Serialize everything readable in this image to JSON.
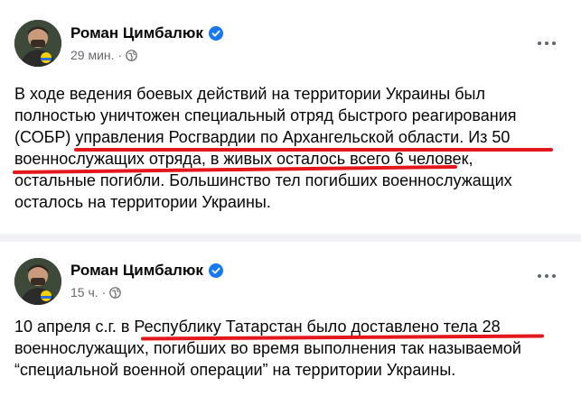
{
  "posts": [
    {
      "author": "Роман Цимбалюк",
      "time": "29 мин.",
      "separator": "·",
      "lines": [
        "В ходе ведения боевых действий на территории Украины был",
        "полностью уничтожен специальный отряд быстрого реагирования",
        "(СОБР) управления Росгвардии по Архангельской области.  Из 50",
        "военнослужащих отряда, в живых осталось всего 6 человек,",
        "остальные погибли. Большинство тел погибших военнослужащих",
        "осталось на территории Украины."
      ]
    },
    {
      "author": "Роман Цимбалюк",
      "time": "15 ч.",
      "separator": "·",
      "lines": [
        "10 апреля с.г. в Республику Татарстан было доставлено тела 28",
        "военнослужащих, погибших во время выполнения так называемой",
        "“специальной военной операции” на территории Украины."
      ]
    }
  ],
  "colors": {
    "verified_badge": "#1877f2",
    "annotation_underline": "#e4181c",
    "meta_text": "#65676b"
  },
  "icons": {
    "verified": "verified-badge-icon",
    "audience": "globe-icon",
    "menu": "more-options-icon"
  }
}
